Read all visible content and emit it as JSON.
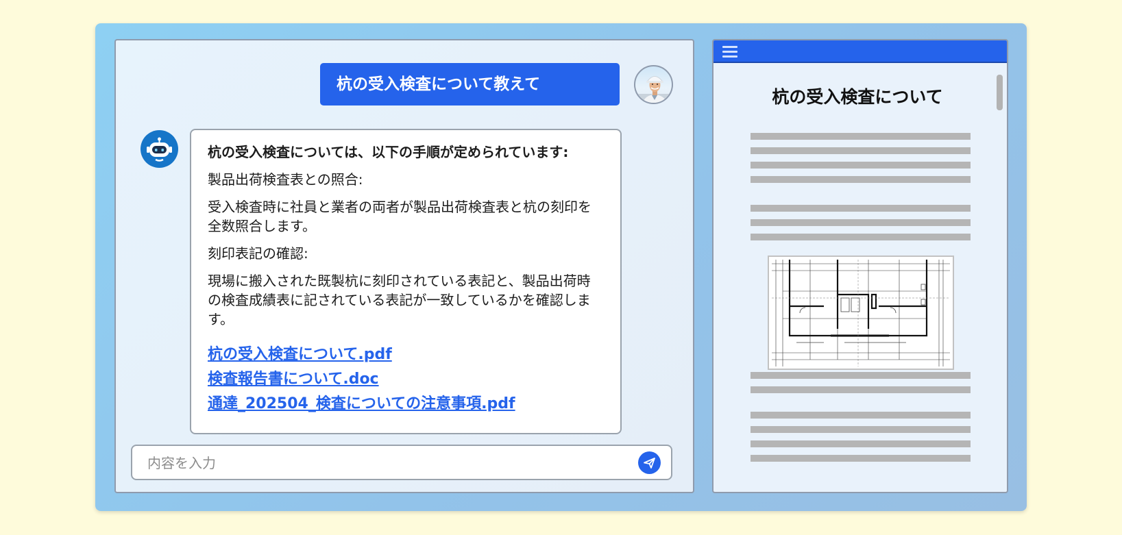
{
  "chat": {
    "user_message": "杭の受入検査について教えて",
    "bot_heading": "杭の受入検査については、以下の手順が定められています:",
    "bot_paragraphs": [
      "製品出荷検査表との照合:",
      "受入検査時に社員と業者の両者が製品出荷検査表と杭の刻印を全数照合します。",
      "刻印表記の確認:",
      "現場に搬入された既製杭に刻印されている表記と、製品出荷時の検査成績表に記されている表記が一致しているかを確認します。"
    ],
    "links": [
      "杭の受入検査について.pdf",
      "検査報告書について.doc",
      "通達_202504_検査についての注意事項.pdf"
    ],
    "input_placeholder": "内容を入力"
  },
  "document": {
    "title": "杭の受入検査について"
  },
  "colors": {
    "accent": "#2563eb",
    "background": "#fefbdb",
    "frame": "#92c3ea",
    "bot_avatar": "#1675c8"
  },
  "icons": {
    "send": "paper-plane-icon",
    "menu": "hamburger-menu-icon",
    "bot": "robot-icon",
    "user": "user-photo-avatar"
  }
}
